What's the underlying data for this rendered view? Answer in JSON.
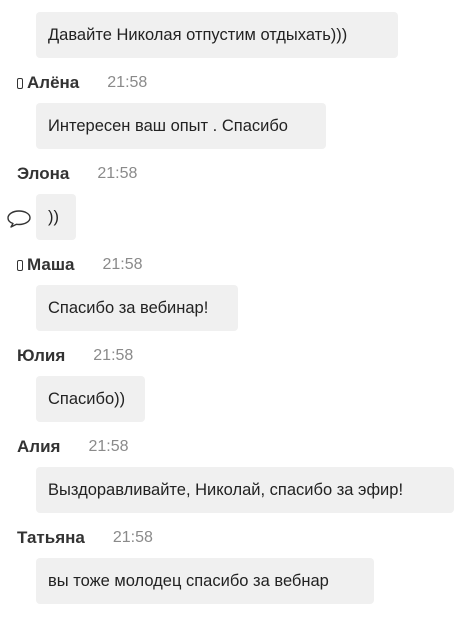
{
  "messages": [
    {
      "author": "",
      "time": "",
      "text": "Давайте Николая отпустим отдыхать)))",
      "phone": false
    },
    {
      "author": "Алёна",
      "time": "21:58",
      "text": "Интересен ваш опыт . Спасибо",
      "phone": true
    },
    {
      "author": "Элона",
      "time": "21:58",
      "text": "))",
      "phone": false
    },
    {
      "author": "Маша",
      "time": "21:58",
      "text": "Спасибо за вебинар!",
      "phone": true
    },
    {
      "author": "Юлия",
      "time": "21:58",
      "text": "Спасибо))",
      "phone": false
    },
    {
      "author": "Алия",
      "time": "21:58",
      "text": "Выздоравливайте, Николай, спасибо за эфир!",
      "phone": false
    },
    {
      "author": "Татьяна",
      "time": "21:58",
      "text": "вы тоже молодец спасибо за вебнар",
      "phone": false
    }
  ],
  "icons": {
    "phone": "phone-icon",
    "reply": "speech-bubble-icon"
  }
}
